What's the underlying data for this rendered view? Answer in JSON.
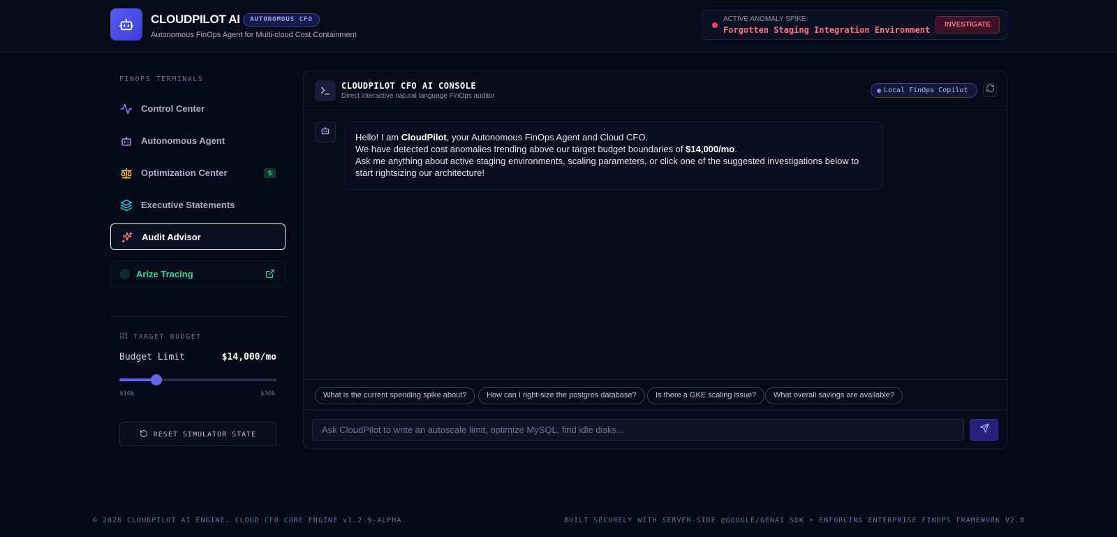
{
  "header": {
    "title": "CLOUDPILOT AI",
    "badge": "AUTONOMOUS CFO",
    "subtitle": "Autonomous FinOps Agent for Multi-cloud Cost Containment",
    "alert": {
      "label": "ACTIVE ANOMALY SPIKE:",
      "text": "Forgotten Staging Integration Environment",
      "button": "INVESTIGATE"
    }
  },
  "sidebar": {
    "heading": "FINOPS TERMINALS",
    "items": [
      {
        "label": "Control Center",
        "icon": "activity-icon"
      },
      {
        "label": "Autonomous Agent",
        "icon": "robot-icon"
      },
      {
        "label": "Optimization Center",
        "icon": "scale-icon",
        "count": "5"
      },
      {
        "label": "Executive Statements",
        "icon": "layers-icon"
      },
      {
        "label": "Audit Advisor",
        "icon": "sparkle-icon",
        "active": true
      }
    ],
    "arize": {
      "label": "Arize Tracing",
      "icon": "external-link-icon"
    },
    "budget": {
      "heading": "TARGET BUDGET",
      "label": "Budget Limit",
      "value": "$14,000/mo",
      "min": "$10k",
      "max": "$30k",
      "level": 14000,
      "range": [
        10000,
        30000
      ]
    },
    "reset_label": "RESET SIMULATOR STATE"
  },
  "console": {
    "title": "CLOUDPILOT CFO AI CONSOLE",
    "subtitle": "Direct interactive natural language FinOps auditor",
    "mode_badge": "Local FinOps Copilot",
    "message": {
      "line1_pre": "Hello! I am ",
      "line1_bold": "CloudPilot",
      "line1_post": ", your Autonomous FinOps Agent and Cloud CFO.",
      "line2_pre": "We have detected cost anomalies trending above our target budget boundaries of ",
      "line2_bold": "$14,000/mo",
      "line2_post": ".",
      "line3": "Ask me anything about active staging environments, scaling parameters, or click one of the suggested investigations below to start rightsizing our architecture!"
    },
    "suggestions": [
      "What is the current spending spike about?",
      "How can I right-size the postgres database?",
      "Is there a GKE scaling issue?",
      "What overall savings are available?"
    ],
    "input_placeholder": "Ask CloudPilot to write an autoscale limit, optimize MySQL, find idle disks..."
  },
  "footer": {
    "left": "© 2026 CLOUDPILOT AI ENGINE. CLOUD CFO CORE ENGINE v1.2.9-ALPHA.",
    "right": "BUILT SECURELY WITH SERVER-SIDE @GOOGLE/GENAI SDK • ENFORCING ENTERPRISE FINOPS FRAMEWORK V2.0"
  },
  "colors": {
    "accent": "#6366f1",
    "alert": "#fb7185",
    "success": "#34d399",
    "background": "#050816"
  }
}
